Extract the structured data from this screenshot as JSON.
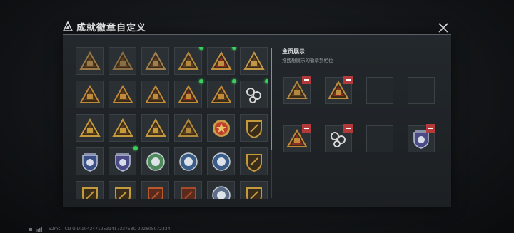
{
  "header": {
    "title": "成就徽章自定义"
  },
  "grid": {
    "badges": [
      {
        "icon": "triangle-emblem-icon",
        "shape": "tri",
        "color": "#9a7a48",
        "new": false
      },
      {
        "icon": "helicopter-emblem-icon",
        "shape": "tri",
        "color": "#8a6e44",
        "new": false
      },
      {
        "icon": "chevron-emblem-icon",
        "shape": "tri",
        "color": "#a08050",
        "new": false
      },
      {
        "icon": "s1-shield-emblem-icon",
        "shape": "tri",
        "color": "#b08840",
        "new": true
      },
      {
        "icon": "scales-emblem-icon",
        "shape": "tri-red",
        "color": "#c09040",
        "new": true
      },
      {
        "icon": "crown-emblem-icon",
        "shape": "tri",
        "color": "#c09848",
        "new": false
      },
      {
        "icon": "beaker-emblem-icon",
        "shape": "tri",
        "color": "#c08a38",
        "new": false
      },
      {
        "icon": "shield-tower-emblem-icon",
        "shape": "tri",
        "color": "#c08a38",
        "new": false
      },
      {
        "icon": "fortress-emblem-icon",
        "shape": "tri",
        "color": "#c08a38",
        "new": false
      },
      {
        "icon": "s6-emblem-icon",
        "shape": "tri-red",
        "color": "#c08a38",
        "new": true
      },
      {
        "icon": "gate-emblem-icon",
        "shape": "tri",
        "color": "#c08a38",
        "new": true
      },
      {
        "icon": "white-chain-emblem-icon",
        "shape": "white",
        "color": "#d8d8d8",
        "new": true
      },
      {
        "icon": "bowl-emblem-icon",
        "shape": "tri",
        "color": "#c49a3c",
        "new": false
      },
      {
        "icon": "number-1-emblem-icon",
        "shape": "tri",
        "color": "#c49a3c",
        "new": false
      },
      {
        "icon": "number-2-emblem-icon",
        "shape": "tri",
        "color": "#c49a3c",
        "new": false
      },
      {
        "icon": "eagle-emblem-icon",
        "shape": "tri",
        "color": "#b08a3a",
        "new": false
      },
      {
        "icon": "star-medal-icon",
        "shape": "medal",
        "color": "#c0402c",
        "new": false
      },
      {
        "icon": "arrow-shield-icon",
        "shape": "shield",
        "color": "#c49a3c",
        "new": false
      },
      {
        "icon": "blue-shield-badge-icon",
        "shape": "blue-badge",
        "color": "#3a4f86",
        "new": false
      },
      {
        "icon": "purple-shield-badge-icon",
        "shape": "blue-badge",
        "color": "#4c4a86",
        "new": true
      },
      {
        "icon": "green-flower-medal-icon",
        "shape": "round-green",
        "color": "#4c8a5a",
        "new": false
      },
      {
        "icon": "eagle-round-medal-icon",
        "shape": "round-blue",
        "color": "#3a5c88",
        "new": false
      },
      {
        "icon": "shark-round-medal-icon",
        "shape": "round-blue",
        "color": "#3a5c88",
        "new": false
      },
      {
        "icon": "sword-shield-icon",
        "shape": "shield",
        "color": "#c49a3c",
        "new": false
      },
      {
        "icon": "dagger-shield-icon",
        "shape": "shield",
        "color": "#c49a3c",
        "new": false
      },
      {
        "icon": "axe-shield-icon",
        "shape": "shield",
        "color": "#c49a3c",
        "new": false
      },
      {
        "icon": "crossed-swords-badge-icon",
        "shape": "shield-red",
        "color": "#b8582c",
        "new": false
      },
      {
        "icon": "wolf-badge-icon",
        "shape": "shield-red",
        "color": "#a84a2c",
        "new": false
      },
      {
        "icon": "dragon-round-icon",
        "shape": "round-blue",
        "color": "#5a6c88",
        "new": false
      },
      {
        "icon": "lion-badge-icon",
        "shape": "shield",
        "color": "#c49a3c",
        "new": false
      }
    ]
  },
  "showcase": {
    "title": "主页展示",
    "subtitle": "拖拽想展示的徽章到栏位",
    "slots": [
      {
        "icon": "s1-shield-emblem-icon",
        "shape": "tri",
        "color": "#b08840",
        "filled": true
      },
      {
        "icon": "scales-emblem-icon",
        "shape": "tri-red",
        "color": "#c09040",
        "filled": true
      },
      {
        "icon": "empty-slot-icon",
        "shape": "none",
        "color": "",
        "filled": false
      },
      {
        "icon": "empty-slot-icon",
        "shape": "none",
        "color": "",
        "filled": false
      },
      {
        "icon": "s6-emblem-icon",
        "shape": "tri-red",
        "color": "#c08a38",
        "filled": true
      },
      {
        "icon": "white-chain-emblem-icon",
        "shape": "white",
        "color": "#d8d8d8",
        "filled": true
      },
      {
        "icon": "empty-slot-icon",
        "shape": "none",
        "color": "",
        "filled": false
      },
      {
        "icon": "purple-shield-badge-icon",
        "shape": "blue-badge",
        "color": "#4c4a86",
        "filled": true
      }
    ]
  },
  "footer": {
    "ping": "52ms",
    "uid": "CN UID:1042471253141733753C 202605072334"
  },
  "colors": {
    "new_dot": "#38d05a",
    "remove": "#b23a3a"
  }
}
